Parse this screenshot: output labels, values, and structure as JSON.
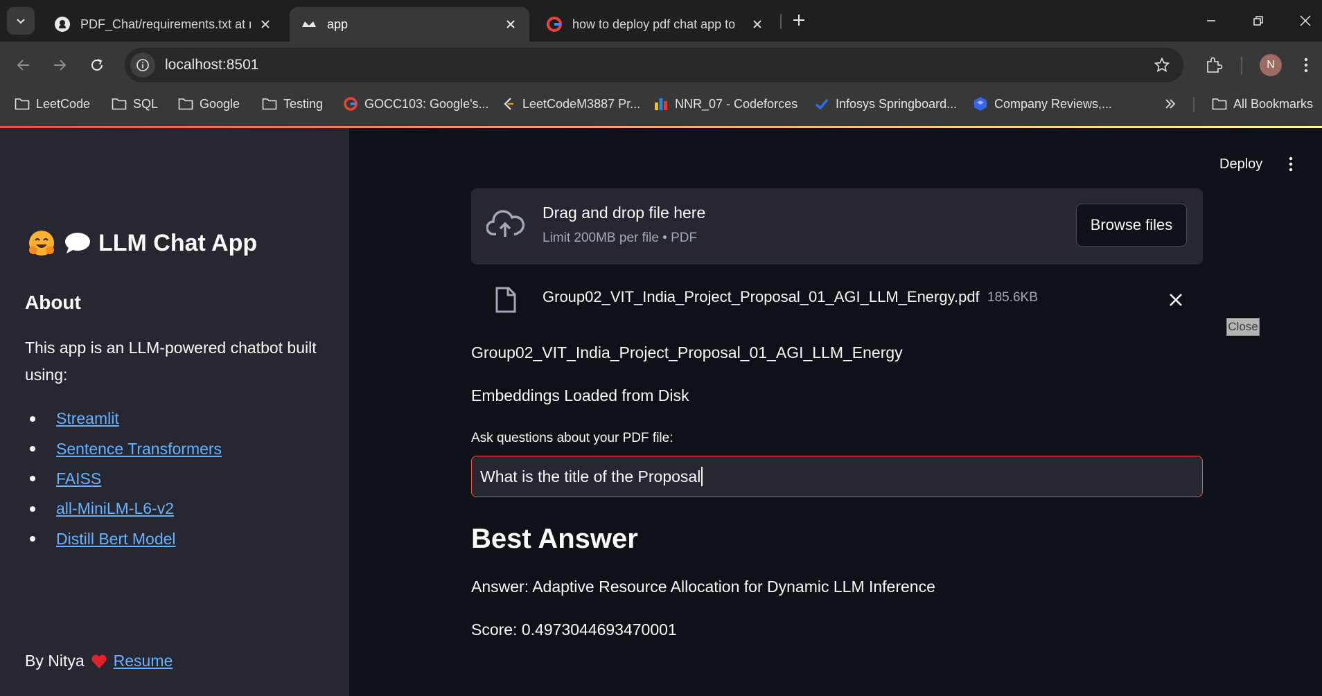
{
  "browser": {
    "tabs": [
      {
        "title": "PDF_Chat/requirements.txt at m",
        "favicon": "github-icon",
        "active": false
      },
      {
        "title": "app",
        "favicon": "streamlit-icon",
        "active": true
      },
      {
        "title": "how to deploy pdf chat app to",
        "favicon": "google-icon",
        "active": false
      }
    ],
    "url": "localhost:8501",
    "profile_initial": "N",
    "bookmarks": [
      {
        "label": "LeetCode",
        "icon": "folder-icon"
      },
      {
        "label": "SQL",
        "icon": "folder-icon"
      },
      {
        "label": "Google",
        "icon": "folder-icon"
      },
      {
        "label": "Testing",
        "icon": "folder-icon"
      },
      {
        "label": "GOCC103: Google's...",
        "icon": "google-icon"
      },
      {
        "label": "LeetCodeM3887 Pr...",
        "icon": "leetcode-icon"
      },
      {
        "label": "NNR_07 - Codeforces",
        "icon": "codeforces-icon"
      },
      {
        "label": "Infosys Springboard...",
        "icon": "infosys-icon"
      },
      {
        "label": "Company Reviews,...",
        "icon": "company-icon"
      }
    ],
    "all_bookmarks_label": "All Bookmarks"
  },
  "sidebar": {
    "title": "LLM Chat App",
    "about_heading": "About",
    "description": "This app is an LLM-powered chatbot built using:",
    "links": [
      "Streamlit",
      "Sentence Transformers",
      "FAISS",
      "all-MiniLM-L6-v2",
      "Distill Bert Model"
    ],
    "footer_prefix": "By Nitya",
    "footer_link": "Resume"
  },
  "header": {
    "deploy_label": "Deploy"
  },
  "uploader": {
    "drag_text": "Drag and drop file here",
    "limit_text": "Limit 200MB per file • PDF",
    "browse_label": "Browse files",
    "file_name": "Group02_VIT_India_Project_Proposal_01_AGI_LLM_Energy.pdf",
    "file_size": "185.6KB"
  },
  "close_label": "Close",
  "main": {
    "doc_name": "Group02_VIT_India_Project_Proposal_01_AGI_LLM_Energy",
    "embeddings_status": "Embeddings Loaded from Disk",
    "question_label": "Ask questions about your PDF file:",
    "question_value": "What is the title of the Proposal",
    "answer_heading": "Best Answer",
    "answer_text": "Answer: Adaptive Resource Allocation for Dynamic LLM Inference",
    "score_text": "Score: 0.4973044693470001"
  },
  "colors": {
    "app_background": "#0e1117",
    "sidebar_background": "#262730",
    "link": "#66b2ff",
    "input_border_focus": "#ff4b4b"
  }
}
